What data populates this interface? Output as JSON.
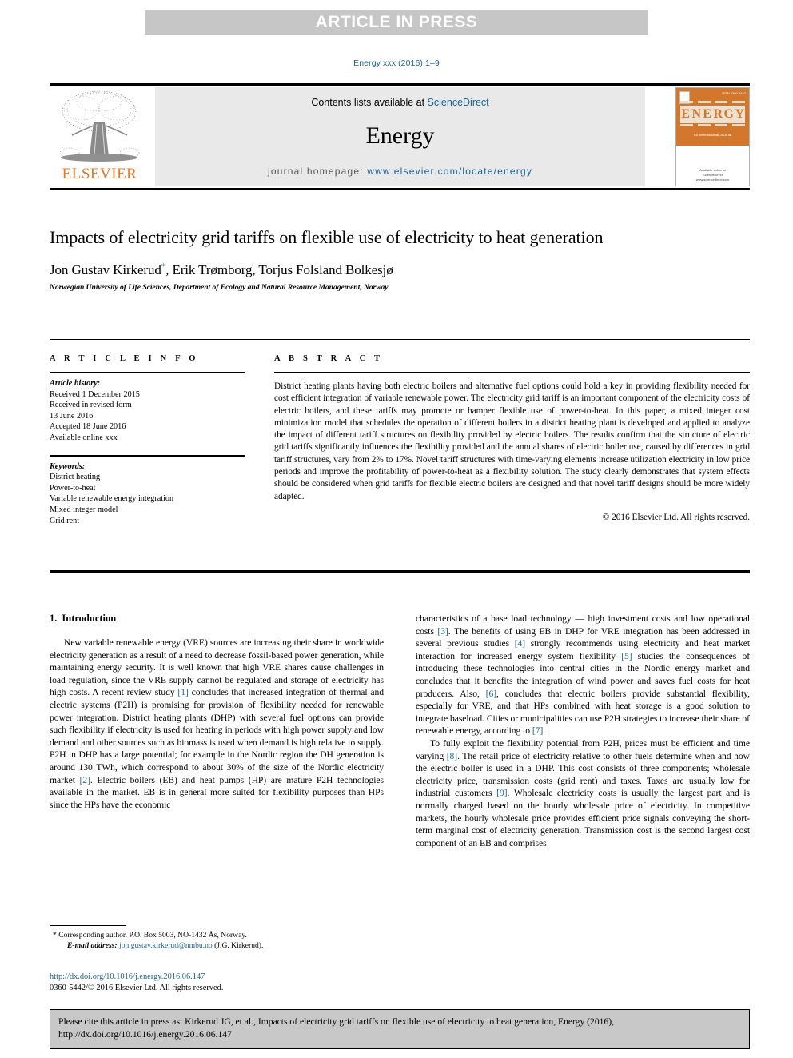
{
  "banner": {
    "label": "ARTICLE IN PRESS"
  },
  "journal_ref": "Energy xxx (2016) 1–9",
  "masthead": {
    "contents_prefix": "Contents lists available at ",
    "sciencedirect": "ScienceDirect",
    "journal_title": "Energy",
    "homepage_prefix": "journal homepage: ",
    "homepage_url": "www.elsevier.com/locate/energy",
    "publisher": "ELSEVIER",
    "cover": {
      "title_letters": [
        "E",
        "N",
        "E",
        "R",
        "G",
        "Y"
      ],
      "tagline": "An International Journal",
      "issn": "ISSN 0360-5442",
      "publisher_note": "Available online at\nScienceDirect\nwww.sciencedirect.com"
    }
  },
  "article": {
    "title": "Impacts of electricity grid tariffs on flexible use of electricity to heat generation",
    "authors": "Jon Gustav Kirkerud, Erik Trømborg, Torjus Folsland Bolkesjø",
    "author_marker": "*",
    "affiliation": "Norwegian University of Life Sciences, Department of Ecology and Natural Resource Management, Norway"
  },
  "info": {
    "heading": "A R T I C L E   I N F O",
    "history_label": "Article history:",
    "history_lines": [
      "Received 1 December 2015",
      "Received in revised form",
      "13 June 2016",
      "Accepted 18 June 2016",
      "Available online xxx"
    ],
    "keywords_label": "Keywords:",
    "keywords": [
      "District heating",
      "Power-to-heat",
      "Variable renewable energy integration",
      "Mixed integer model",
      "Grid rent"
    ]
  },
  "abstract": {
    "heading": "A B S T R A C T",
    "text": "District heating plants having both electric boilers and alternative fuel options could hold a key in providing flexibility needed for cost efficient integration of variable renewable power. The electricity grid tariff is an important component of the electricity costs of electric boilers, and these tariffs may promote or hamper flexible use of power-to-heat. In this paper, a mixed integer cost minimization model that schedules the operation of different boilers in a district heating plant is developed and applied to analyze the impact of different tariff structures on flexibility provided by electric boilers. The results confirm that the structure of electric grid tariffs significantly influences the flexibility provided and the annual shares of electric boiler use, caused by differences in grid tariff structures, vary from 2% to 17%. Novel tariff structures with time-varying elements increase utilization electricity in low price periods and improve the profitability of power-to-heat as a flexibility solution. The study clearly demonstrates that system effects should be considered when grid tariffs for flexible electric boilers are designed and that novel tariff designs should be more widely adapted.",
    "copyright": "© 2016 Elsevier Ltd. All rights reserved."
  },
  "body": {
    "section_number": "1.",
    "section_title": "Introduction",
    "left_p1_a": "New variable renewable energy (VRE) sources are increasing their share in worldwide electricity generation as a result of a need to decrease fossil-based power generation, while maintaining energy security. It is well known that high VRE shares cause challenges in load regulation, since the VRE supply cannot be regulated and storage of electricity has high costs. A recent review study ",
    "left_ref_1": "[1]",
    "left_p1_b": " concludes that increased integration of thermal and electric systems (P2H) is promising for provision of flexibility needed for renewable power integration. District heating plants (DHP) with several fuel options can provide such flexibility if electricity is used for heating in periods with high power supply and low demand and other sources such as biomass is used when demand is high relative to supply. P2H in DHP has a large potential; for example in the Nordic region the DH generation is around 130 TWh, which correspond to about 30% of the size of the Nordic electricity market ",
    "left_ref_2": "[2]",
    "left_p1_c": ". Electric boilers (EB) and heat pumps (HP) are mature P2H technologies available in the market. EB is in general more suited for flexibility purposes than HPs since the HPs have the economic",
    "right_p1_a": "characteristics of a base load technology — high investment costs and low operational costs ",
    "right_ref_3": "[3]",
    "right_p1_b": ". The benefits of using EB in DHP for VRE integration has been addressed in several previous studies ",
    "right_ref_4": "[4]",
    "right_p1_c": " strongly recommends using electricity and heat market interaction for increased energy system flexibility ",
    "right_ref_5": "[5]",
    "right_p1_d": " studies the consequences of introducing these technologies into central cities in the Nordic energy market and concludes that it benefits the integration of wind power and saves fuel costs for heat producers. Also, ",
    "right_ref_6": "[6]",
    "right_p1_e": ", concludes that electric boilers provide substantial flexibility, especially for VRE, and that HPs combined with heat storage is a good solution to integrate baseload. Cities or municipalities can use P2H strategies to increase their share of renewable energy, according to ",
    "right_ref_7": "[7]",
    "right_p1_f": ".",
    "right_p2_a": "To fully exploit the flexibility potential from P2H, prices must be efficient and time varying ",
    "right_ref_8": "[8]",
    "right_p2_b": ". The retail price of electricity relative to other fuels determine when and how the electric boiler is used in a DHP. This cost consists of three components; wholesale electricity price, transmission costs (grid rent) and taxes. Taxes are usually low for industrial customers ",
    "right_ref_9": "[9]",
    "right_p2_c": ". Wholesale electricity costs is usually the largest part and is normally charged based on the hourly wholesale price of electricity. In competitive markets, the hourly wholesale price provides efficient price signals conveying the short-term marginal cost of electricity generation. Transmission cost is the second largest cost component of an EB and comprises"
  },
  "footnote": {
    "marker": "*",
    "corresponding": " Corresponding author. P.O. Box 5003, NO-1432 Ås, Norway.",
    "email_label": "E-mail address:",
    "email": "jon.gustav.kirkerud@nmbu.no",
    "email_suffix": " (J.G. Kirkerud).",
    "doi": "http://dx.doi.org/10.1016/j.energy.2016.06.147",
    "issn_copyright": "0360-5442/© 2016 Elsevier Ltd. All rights reserved."
  },
  "cite_box": {
    "text": "Please cite this article in press as: Kirkerud JG, et al., Impacts of electricity grid tariffs on flexible use of electricity to heat generation, Energy (2016), http://dx.doi.org/10.1016/j.energy.2016.06.147"
  },
  "colors": {
    "link": "#1a6496",
    "banner_bg": "#c6c6c6",
    "masthead_bg": "#e9e9e9",
    "elsevier_orange": "#e87722",
    "cite_bg": "#c8c8c8"
  }
}
